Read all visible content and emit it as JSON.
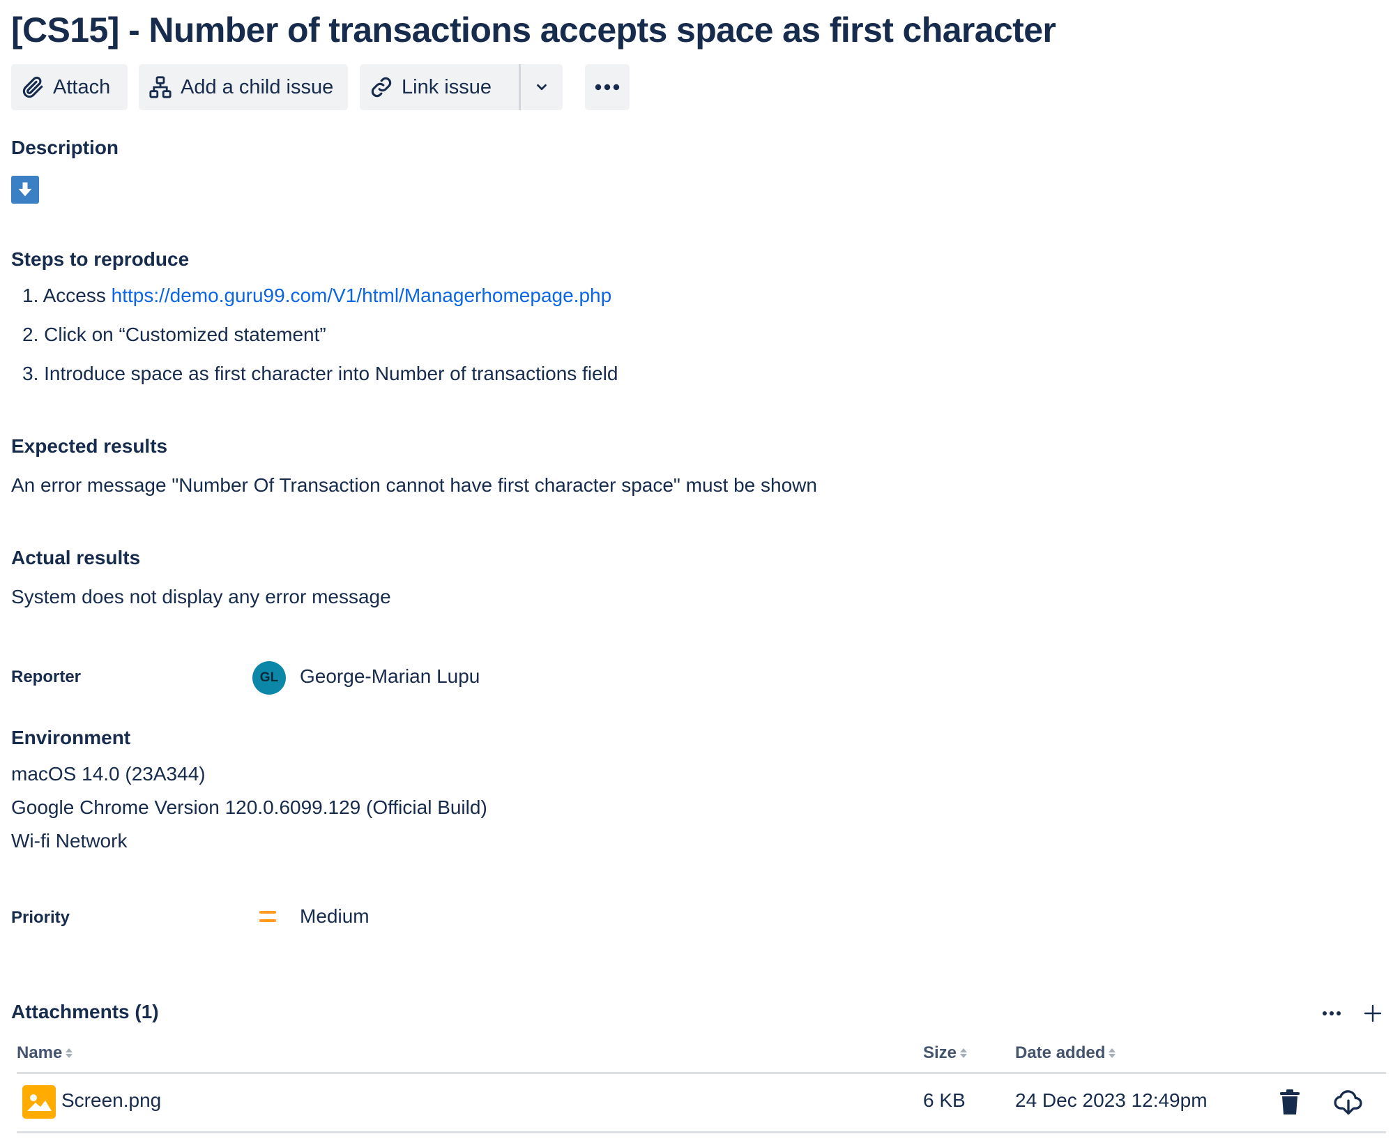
{
  "issue": {
    "title": "[CS15] - Number of transactions accepts space as first character"
  },
  "toolbar": {
    "attach_label": "Attach",
    "add_child_label": "Add a child issue",
    "link_issue_label": "Link issue"
  },
  "description": {
    "heading": "Description",
    "steps_heading": "Steps to reproduce",
    "steps": [
      {
        "num": "1.",
        "prefix": "Access ",
        "link": "https://demo.guru99.com/V1/html/Managerhomepage.php"
      },
      {
        "num": "2.",
        "text": "Click on “Customized statement”"
      },
      {
        "num": "3.",
        "text": "Introduce space as first character into Number of transactions field"
      }
    ],
    "expected_heading": "Expected results",
    "expected_text": "An error message \"Number Of Transaction cannot have first character space\" must be shown",
    "actual_heading": "Actual results",
    "actual_text": "System does not display any error message"
  },
  "reporter": {
    "label": "Reporter",
    "initials": "GL",
    "name": "George-Marian Lupu",
    "avatar_color": "#0c87a7"
  },
  "environment": {
    "heading": "Environment",
    "lines": [
      "macOS 14.0 (23A344)",
      "Google Chrome Version 120.0.6099.129 (Official Build)",
      "Wi-fi Network"
    ]
  },
  "priority": {
    "label": "Priority",
    "value": "Medium",
    "icon": "priority-medium-icon",
    "color": "#ff991f"
  },
  "attachments": {
    "heading": "Attachments (1)",
    "columns": {
      "name": "Name",
      "size": "Size",
      "date": "Date added"
    },
    "rows": [
      {
        "name": "Screen.png",
        "size": "6 KB",
        "date": "24 Dec 2023 12:49pm",
        "icon": "image-file-icon"
      }
    ]
  },
  "colors": {
    "text": "#172b4d",
    "link": "#0c66e4",
    "button_bg": "#f1f2f4",
    "description_icon": "#3b7fc4",
    "image_icon": "#ffab00"
  }
}
